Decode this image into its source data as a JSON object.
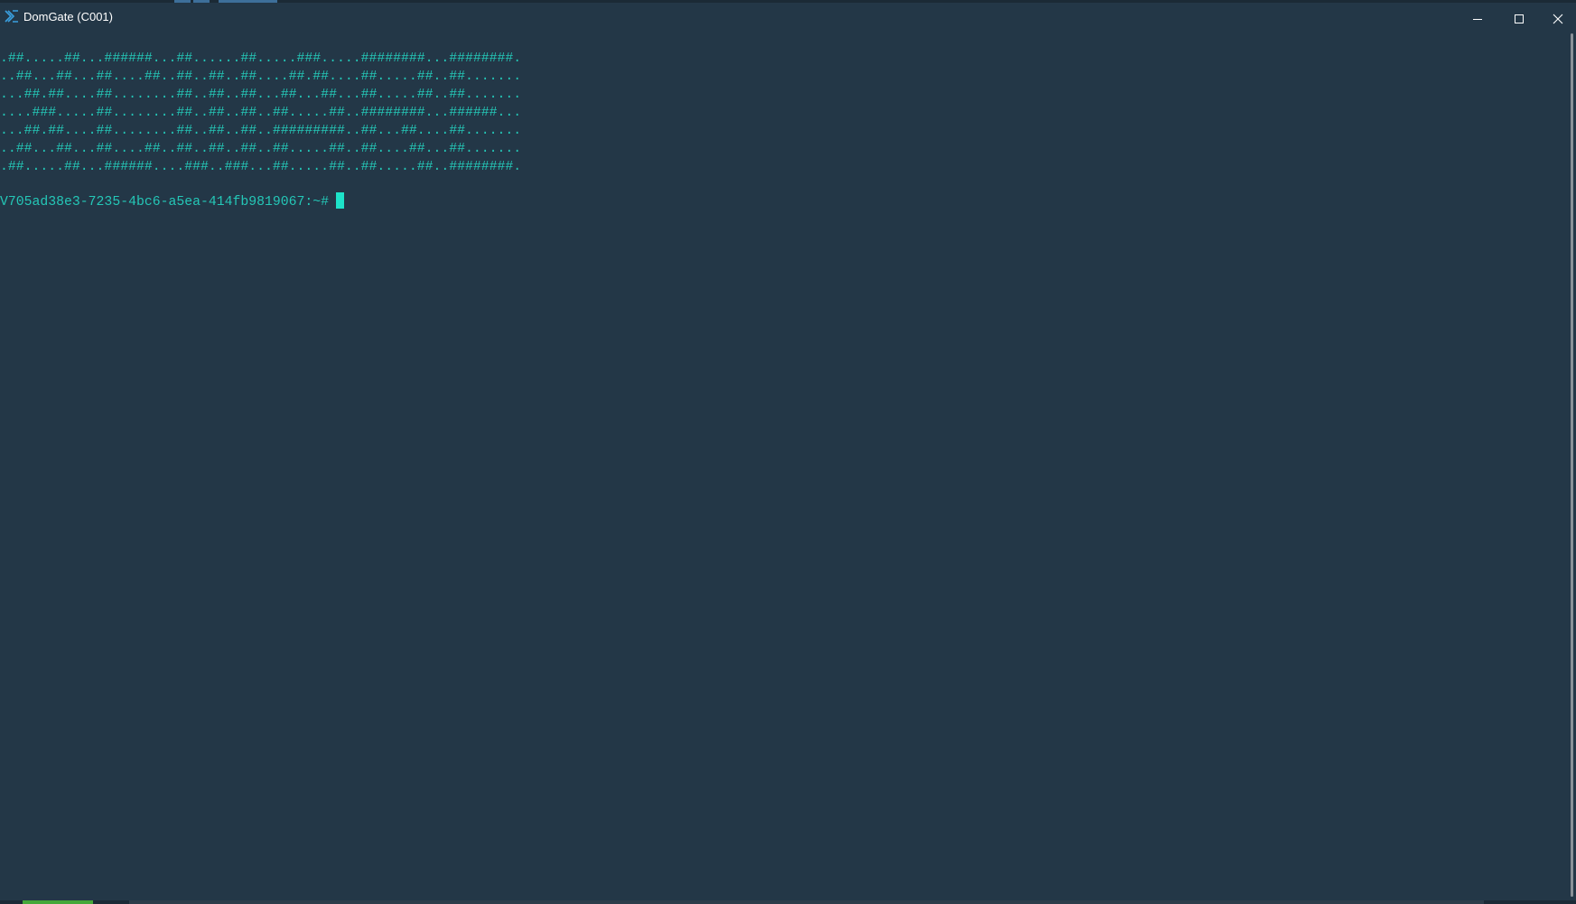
{
  "window": {
    "title": "DomGate (C001)",
    "app_icon": "domgate-logo-icon",
    "controls": {
      "minimize_icon": "minimize-icon",
      "maximize_icon": "maximize-icon",
      "close_icon": "close-icon"
    }
  },
  "terminal": {
    "banner_lines": [
      ".##.....##...######...##......##.....###.....########...########.",
      "..##...##...##....##..##..##..##....##.##....##.....##..##.......",
      "...##.##....##........##..##..##...##...##...##.....##..##.......",
      "....###.....##........##..##..##..##.....##..########...######...",
      "...##.##....##........##..##..##..#########..##...##....##.......",
      "..##...##...##....##..##..##..##..##.....##..##....##...##.......",
      ".##.....##...######....###..###...##.....##..##.....##..########."
    ],
    "prompt": "V705ad38e3-7235-4bc6-a5ea-414fb9819067:~#"
  },
  "colors": {
    "background": "#233747",
    "terminal_text": "#24c7b7",
    "cursor": "#1de2c9",
    "title_text": "#ffffff"
  }
}
